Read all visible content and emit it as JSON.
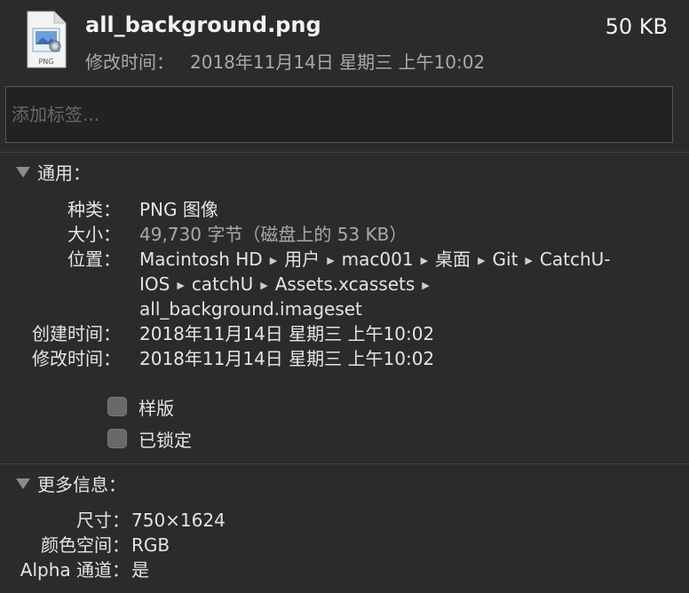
{
  "header": {
    "filename": "all_background.png",
    "filesize": "50 KB",
    "modified_label": "修改时间：",
    "modified_value": "2018年11月14日 星期三 上午10:02",
    "icon_badge": "PNG",
    "icon": "png-image-file-icon"
  },
  "tags": {
    "placeholder": "添加标签..."
  },
  "general": {
    "title": "通用：",
    "kind_label": "种类：",
    "kind_value": "PNG 图像",
    "size_label": "大小：",
    "size_value": "49,730 字节（磁盘上的 53 KB）",
    "where_label": "位置：",
    "path": [
      "Macintosh HD",
      "用户",
      "mac001",
      "桌面",
      "Git",
      "CatchU-IOS",
      "catchU",
      "Assets.xcassets",
      "all_background.imageset"
    ],
    "path_line1_a": "Macintosh HD",
    "path_line1_b": "用户",
    "path_line1_c": "mac001",
    "path_line1_d": "桌面",
    "path_line1_e": "Git",
    "path_line1_f": "CatchU-",
    "path_line2_a": "IOS",
    "path_line2_b": "catchU",
    "path_line2_c": "Assets.xcassets",
    "path_line3": "all_background.imageset",
    "created_label": "创建时间：",
    "created_value": "2018年11月14日 星期三 上午10:02",
    "modified_label": "修改时间：",
    "modified_value": "2018年11月14日 星期三 上午10:02",
    "stationery_label": "样版",
    "stationery_checked": false,
    "locked_label": "已锁定",
    "locked_checked": false
  },
  "more_info": {
    "title": "更多信息：",
    "dimensions_label": "尺寸：",
    "dimensions_value": "750×1624",
    "colorspace_label": "颜色空间：",
    "colorspace_value": "RGB",
    "alpha_label": "Alpha 通道：",
    "alpha_value": "是"
  },
  "colors": {
    "background": "#2c2b2a",
    "text": "#e4e4e4",
    "dim_text": "#a9a9a9"
  }
}
